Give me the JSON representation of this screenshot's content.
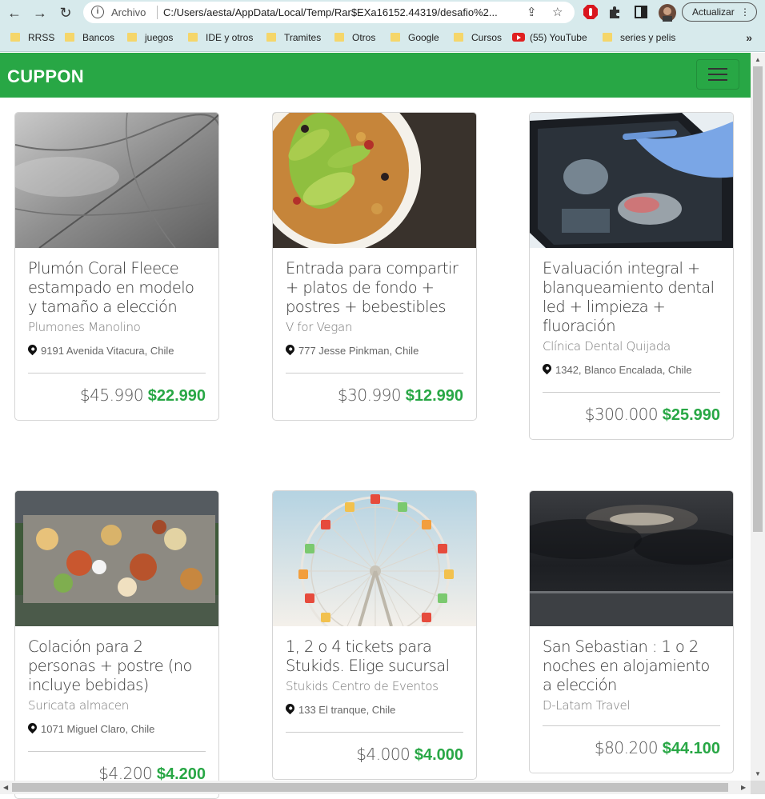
{
  "browser": {
    "scheme_label": "Archivo",
    "url": "C:/Users/aesta/AppData/Local/Temp/Rar$EXa16152.44319/desafio%2...",
    "update_label": "Actualizar"
  },
  "bookmarks": [
    {
      "label": "RRSS",
      "type": "folder"
    },
    {
      "label": "Bancos",
      "type": "folder"
    },
    {
      "label": "juegos",
      "type": "folder"
    },
    {
      "label": "IDE y otros",
      "type": "folder"
    },
    {
      "label": "Tramites",
      "type": "folder"
    },
    {
      "label": "Otros",
      "type": "folder"
    },
    {
      "label": "Google",
      "type": "folder"
    },
    {
      "label": "Cursos",
      "type": "folder"
    },
    {
      "label": "(55) YouTube",
      "type": "youtube"
    },
    {
      "label": "series y pelis",
      "type": "folder"
    }
  ],
  "brand": "CUPPON",
  "colors": {
    "accent": "#28a745"
  },
  "cards": [
    {
      "title": "Plumón Coral Fleece estampado en modelo y tamaño a elección",
      "vendor": "Plumones Manolino",
      "address": "9191 Avenida Vitacura, Chile",
      "old_price": "$45.990",
      "new_price": "$22.990",
      "image": "grey-quilted-blanket"
    },
    {
      "title": "Entrada para compartir + platos de fondo + postres + bebestibles",
      "vendor": "V for Vegan",
      "address": "777 Jesse Pinkman, Chile",
      "old_price": "$30.990",
      "new_price": "$12.990",
      "image": "avocado-salad-bowl"
    },
    {
      "title": "Evaluación integral + blanqueamiento dental led + limpieza + fluoración",
      "vendor": "Clínica Dental Quijada",
      "address": "1342, Blanco Encalada, Chile",
      "old_price": "$300.000",
      "new_price": "$25.990",
      "image": "dental-xray-tablet"
    },
    {
      "title": "Colación para 2 personas + postre (no incluye bebidas)",
      "vendor": "Suricata almacen",
      "address": "1071 Miguel Claro, Chile",
      "old_price": "$4.200",
      "new_price": "$4.200",
      "image": "shared-food-table"
    },
    {
      "title": "1, 2 o 4 tickets para Stukids. Elige sucursal",
      "vendor": "Stukids Centro de Eventos",
      "address": "133 El tranque, Chile",
      "old_price": "$4.000",
      "new_price": "$4.000",
      "image": "ferris-wheel"
    },
    {
      "title": "San Sebastian : 1 o 2 noches en alojamiento a elección",
      "vendor": "D-Latam Travel",
      "address": "",
      "old_price": "$80.200",
      "new_price": "$44.100",
      "image": "stormy-sea-sky"
    }
  ]
}
